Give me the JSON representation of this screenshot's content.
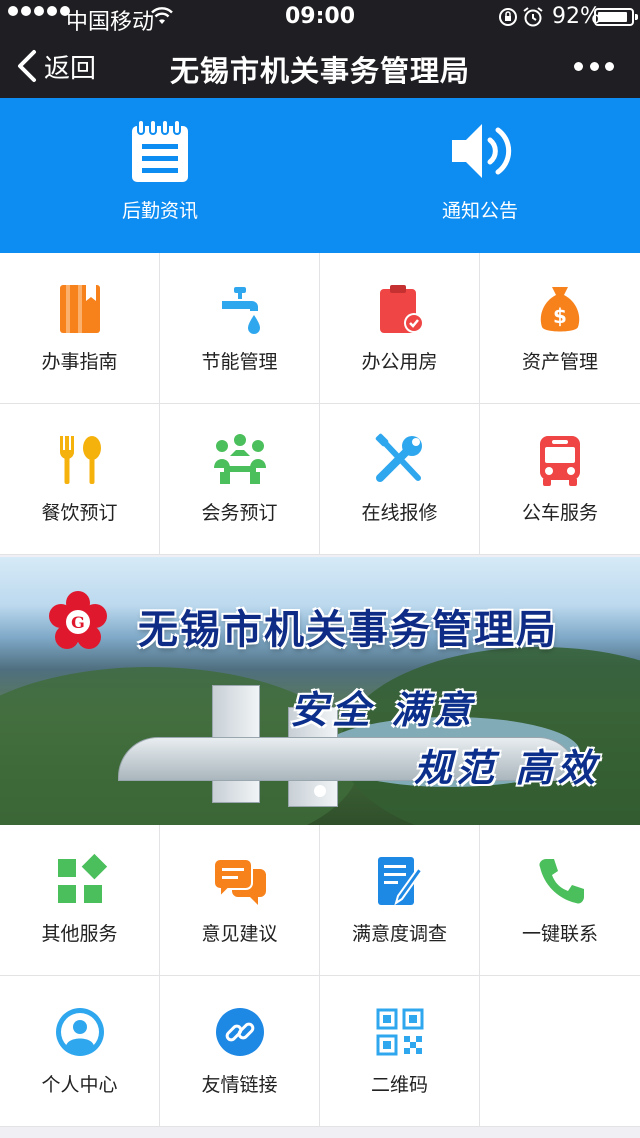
{
  "status_bar": {
    "carrier": "中国移动",
    "time": "09:00",
    "battery_percent": "92%",
    "battery_level": 0.92,
    "signal_bars": 5,
    "icons": [
      "signal-dots-icon",
      "wifi-icon",
      "rotation-lock-icon",
      "alarm-icon",
      "battery-icon"
    ]
  },
  "nav": {
    "back_label": "返回",
    "title": "无锡市机关事务管理局",
    "more_icon": "more-dots-icon"
  },
  "top_band": {
    "color": "#0d8cf2",
    "items": [
      {
        "label": "后勤资讯",
        "icon": "notepad-icon"
      },
      {
        "label": "通知公告",
        "icon": "speaker-icon"
      }
    ]
  },
  "services": [
    {
      "label": "办事指南",
      "icon": "guide-book-icon",
      "color": "#f7821b"
    },
    {
      "label": "节能管理",
      "icon": "water-tap-icon",
      "color": "#2fa7ee"
    },
    {
      "label": "办公用房",
      "icon": "clipboard-check-icon",
      "color": "#ef4545"
    },
    {
      "label": "资产管理",
      "icon": "money-bag-icon",
      "color": "#f7821b"
    },
    {
      "label": "餐饮预订",
      "icon": "fork-spoon-icon",
      "color": "#f5b10c"
    },
    {
      "label": "会务预订",
      "icon": "meeting-icon",
      "color": "#4bbf5b"
    },
    {
      "label": "在线报修",
      "icon": "repair-tools-icon",
      "color": "#2fa7ee"
    },
    {
      "label": "公车服务",
      "icon": "bus-icon",
      "color": "#ef4545"
    }
  ],
  "banner": {
    "title": "无锡市机关事务管理局",
    "slogan_line1": "安全 满意",
    "slogan_line2": "规范 高效",
    "active_slide": 1
  },
  "more_services": [
    {
      "label": "其他服务",
      "icon": "apps-grid-icon",
      "color": "#4bbf5b"
    },
    {
      "label": "意见建议",
      "icon": "chat-bubbles-icon",
      "color": "#f7821b"
    },
    {
      "label": "满意度调查",
      "icon": "survey-edit-icon",
      "color": "#1e88e5"
    },
    {
      "label": "一键联系",
      "icon": "phone-icon",
      "color": "#4bbf5b"
    },
    {
      "label": "个人中心",
      "icon": "user-profile-icon",
      "color": "#2fa7ee"
    },
    {
      "label": "友情链接",
      "icon": "link-icon",
      "color": "#1e88e5"
    },
    {
      "label": "二维码",
      "icon": "qr-code-icon",
      "color": "#2fa7ee"
    }
  ]
}
